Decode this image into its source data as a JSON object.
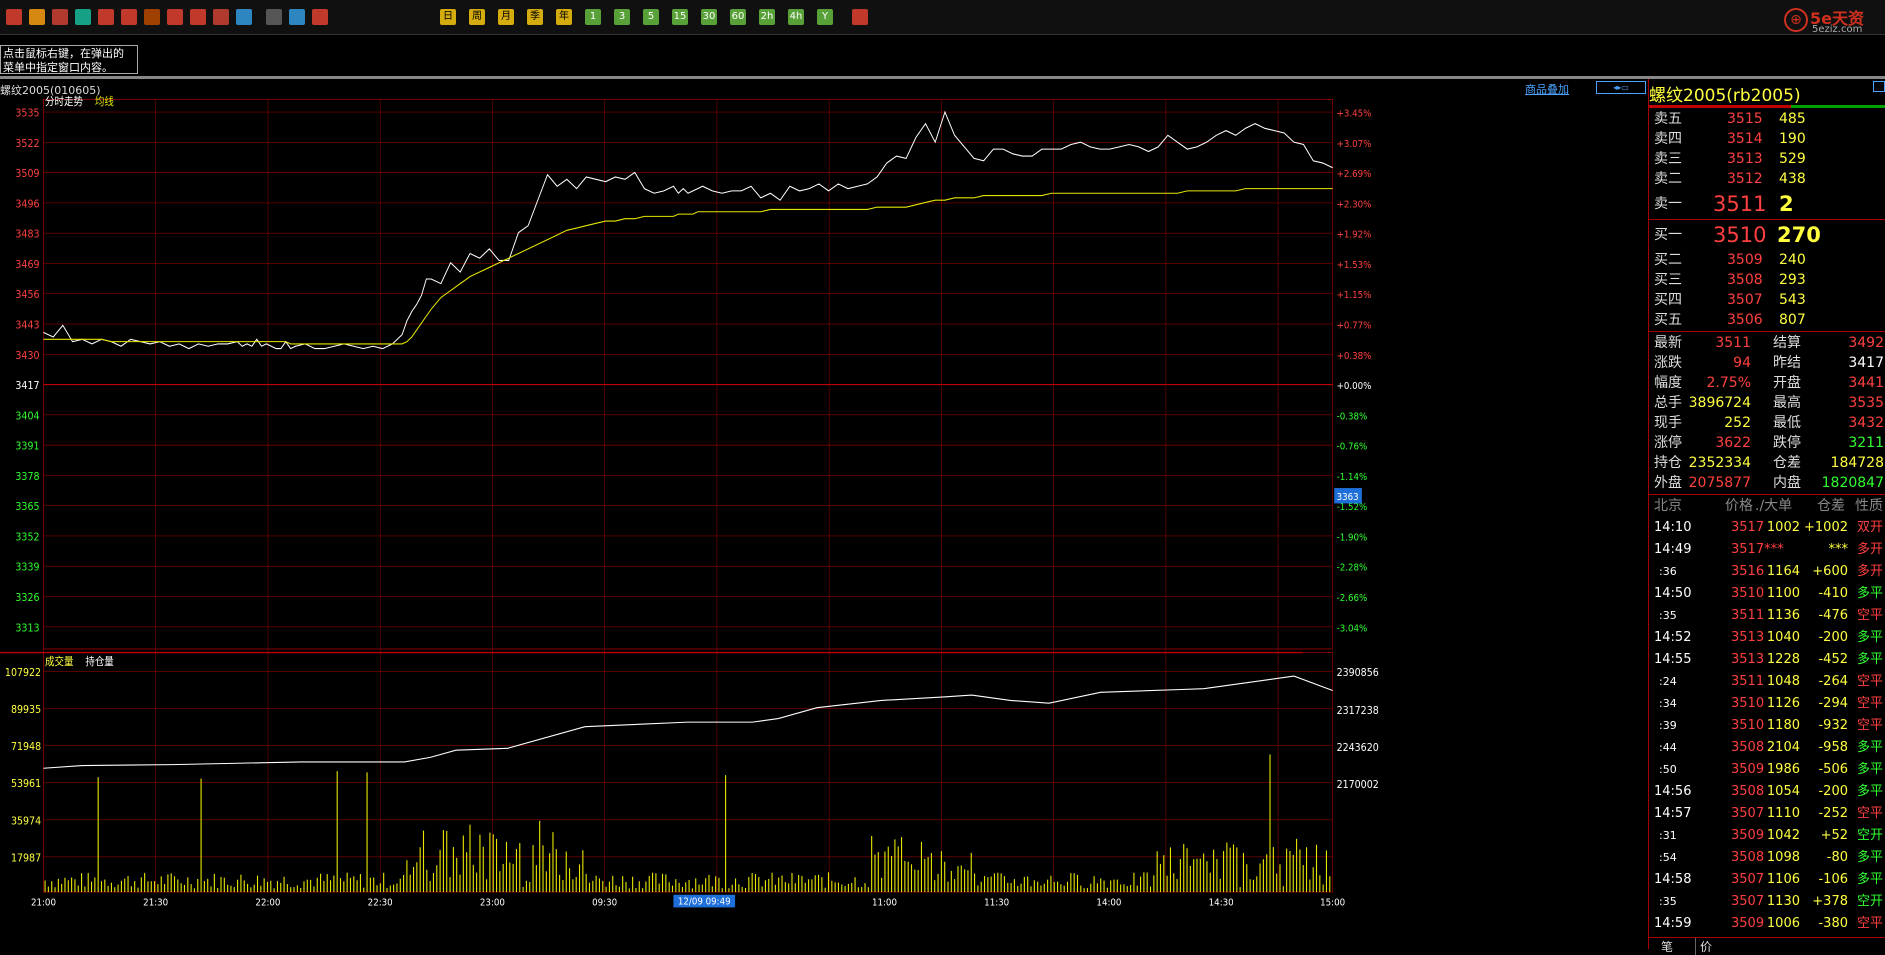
{
  "toolbar": {
    "icons": [
      "home-icon",
      "folder-icon",
      "chart-icon",
      "refresh-icon",
      "zoom-in-icon",
      "zoom-out-icon",
      "window-icon",
      "draw-icon",
      "brush-icon",
      "filter-icon",
      "analysis-icon",
      "table-icon",
      "trend-icon",
      "kline-icon",
      "period-daily",
      "period-weekly",
      "period-monthly",
      "period-quarterly",
      "period-yearly",
      "period-1min",
      "period-3min",
      "period-5min",
      "period-15min",
      "period-30min",
      "period-60min",
      "period-2h",
      "period-4h",
      "period-year",
      "calendar-icon"
    ],
    "period_labels": [
      "日",
      "周",
      "月",
      "季",
      "年",
      "1",
      "3",
      "5",
      "15",
      "30",
      "60",
      "2h",
      "4h",
      "Y"
    ]
  },
  "brand": {
    "name": "5e天资",
    "domain": "5eziz.com"
  },
  "tooltip": {
    "line1": "点击鼠标右键，在弹出的",
    "line2": "菜单中指定窗口内容。"
  },
  "symbol_line": "螺纹2005(010605)",
  "overlay_link": "商品叠加",
  "main_chart": {
    "legend": {
      "price_label": "分时走势",
      "avg_label": "均线"
    },
    "left_ticks": [
      "3535",
      "3522",
      "3509",
      "3496",
      "3483",
      "3469",
      "3456",
      "3443",
      "3430",
      "3417",
      "3404",
      "3391",
      "3378",
      "3365",
      "3352",
      "3339",
      "3326",
      "3313"
    ],
    "right_ticks": [
      "+3.45%",
      "+3.07%",
      "+2.69%",
      "+2.30%",
      "+1.92%",
      "+1.53%",
      "+1.15%",
      "+0.77%",
      "+0.38%",
      "+0.00%",
      "-0.38%",
      "-0.76%",
      "-1.14%",
      "-1.52%",
      "-1.90%",
      "-2.28%",
      "-2.66%",
      "-3.04%"
    ],
    "cursor_value": "3363",
    "prev_settle": 3417
  },
  "volume_chart": {
    "legend": {
      "volume_label": "成交量",
      "oi_label": "持仓量"
    },
    "left_ticks": [
      "107922",
      "89935",
      "71948",
      "53961",
      "35974",
      "17987"
    ],
    "right_ticks": [
      "2390856",
      "2317238",
      "2243620",
      "2170002"
    ]
  },
  "time_axis": [
    "21:00",
    "21:30",
    "22:00",
    "22:30",
    "23:00",
    "09:30",
    "10:00",
    "11:00",
    "11:30",
    "14:00",
    "14:30",
    "15:00"
  ],
  "time_cursor": "12/09 09:49",
  "chart_data": {
    "type": "line",
    "title": "螺纹2005(010605)",
    "x": [
      0,
      10,
      20,
      30,
      40,
      50,
      60,
      70,
      80,
      90,
      100,
      110,
      120,
      130,
      140,
      150,
      160,
      170,
      180,
      190,
      200,
      205,
      210,
      215,
      220,
      225,
      230,
      235,
      240,
      245,
      250,
      255,
      260,
      270,
      280,
      290,
      300,
      310,
      320,
      330,
      340,
      350,
      360,
      370,
      375,
      380,
      385,
      390,
      395,
      400,
      410,
      420,
      430,
      440,
      450,
      460,
      470,
      480,
      490,
      500,
      510,
      520,
      530,
      540,
      550,
      560,
      570,
      580,
      590,
      600,
      610,
      620,
      630,
      640,
      650,
      655,
      660,
      665,
      670,
      675,
      680,
      690,
      700,
      710,
      720,
      730,
      740,
      750,
      760,
      770,
      780,
      790,
      800,
      810,
      820,
      830,
      840,
      850,
      860,
      870,
      880,
      890,
      900,
      910,
      920,
      930,
      940,
      950,
      960,
      970,
      980,
      990,
      1000,
      1010,
      1020,
      1030,
      1040,
      1050,
      1060,
      1070,
      1080,
      1090,
      1100,
      1110,
      1120,
      1130,
      1140,
      1150,
      1160,
      1170,
      1180,
      1190,
      1200,
      1210,
      1220,
      1230,
      1240,
      1250,
      1260,
      1270,
      1280,
      1290,
      1300,
      1310,
      1320,
      1330
    ],
    "series": [
      {
        "name": "分时走势",
        "values": [
          3440,
          3438,
          3443,
          3436,
          3437,
          3435,
          3437,
          3436,
          3434,
          3437,
          3436,
          3435,
          3436,
          3434,
          3435,
          3433,
          3435,
          3434,
          3435,
          3435,
          3436,
          3434,
          3435,
          3434,
          3437,
          3434,
          3435,
          3434,
          3433,
          3433,
          3436,
          3433,
          3434,
          3435,
          3433,
          3433,
          3434,
          3435,
          3434,
          3433,
          3434,
          3433,
          3435,
          3439,
          3445,
          3449,
          3452,
          3456,
          3463,
          3463,
          3461,
          3470,
          3466,
          3474,
          3472,
          3476,
          3471,
          3471,
          3483,
          3486,
          3497,
          3508,
          3503,
          3506,
          3502,
          3507,
          3506,
          3505,
          3507,
          3506,
          3509,
          3502,
          3500,
          3501,
          3503,
          3500,
          3502,
          3500,
          3501,
          3502,
          3503,
          3501,
          3500,
          3501,
          3501,
          3503,
          3498,
          3500,
          3497,
          3503,
          3501,
          3502,
          3504,
          3501,
          3504,
          3502,
          3503,
          3504,
          3507,
          3513,
          3516,
          3515,
          3524,
          3530,
          3522,
          3535,
          3525,
          3520,
          3515,
          3514,
          3519,
          3519,
          3517,
          3516,
          3516,
          3519,
          3519,
          3519,
          3521,
          3522,
          3520,
          3519,
          3519,
          3520,
          3521,
          3520,
          3518,
          3520,
          3525,
          3522,
          3519,
          3520,
          3522,
          3525,
          3527,
          3525,
          3528,
          3530,
          3528,
          3527,
          3526,
          3522,
          3521,
          3514,
          3513,
          3511
        ]
      },
      {
        "name": "均线",
        "values": [
          3437,
          3437,
          3437,
          3437,
          3437,
          3437,
          3437,
          3436,
          3436,
          3436,
          3436,
          3436,
          3436,
          3436,
          3436,
          3436,
          3436,
          3436,
          3436,
          3436,
          3436,
          3436,
          3436,
          3436,
          3436,
          3436,
          3436,
          3436,
          3436,
          3436,
          3436,
          3435,
          3435,
          3435,
          3435,
          3435,
          3435,
          3435,
          3435,
          3435,
          3435,
          3435,
          3435,
          3435,
          3436,
          3438,
          3441,
          3444,
          3447,
          3450,
          3455,
          3458,
          3461,
          3464,
          3466,
          3468,
          3470,
          3472,
          3474,
          3476,
          3478,
          3480,
          3482,
          3484,
          3485,
          3486,
          3487,
          3488,
          3488,
          3489,
          3489,
          3490,
          3490,
          3490,
          3490,
          3491,
          3491,
          3491,
          3491,
          3492,
          3492,
          3492,
          3492,
          3492,
          3492,
          3492,
          3492,
          3493,
          3493,
          3493,
          3493,
          3493,
          3493,
          3493,
          3493,
          3493,
          3493,
          3493,
          3494,
          3494,
          3494,
          3494,
          3495,
          3496,
          3497,
          3497,
          3498,
          3498,
          3498,
          3499,
          3499,
          3499,
          3499,
          3499,
          3499,
          3499,
          3500,
          3500,
          3500,
          3500,
          3500,
          3500,
          3500,
          3500,
          3500,
          3500,
          3500,
          3500,
          3500,
          3500,
          3501,
          3501,
          3501,
          3501,
          3501,
          3501,
          3502,
          3502,
          3502,
          3502,
          3502,
          3502,
          3502,
          3502,
          3502,
          3502
        ]
      }
    ],
    "ylim": [
      3313,
      3535
    ]
  },
  "quote": {
    "title": "螺纹2005(rb2005)",
    "asks": [
      {
        "label": "卖五",
        "price": "3515",
        "vol": "485"
      },
      {
        "label": "卖四",
        "price": "3514",
        "vol": "190"
      },
      {
        "label": "卖三",
        "price": "3513",
        "vol": "529"
      },
      {
        "label": "卖二",
        "price": "3512",
        "vol": "438"
      }
    ],
    "ask1": {
      "label": "卖一",
      "price": "3511",
      "vol": "2"
    },
    "bid1": {
      "label": "买一",
      "price": "3510",
      "vol": "270"
    },
    "bids": [
      {
        "label": "买二",
        "price": "3509",
        "vol": "240"
      },
      {
        "label": "买三",
        "price": "3508",
        "vol": "293"
      },
      {
        "label": "买四",
        "price": "3507",
        "vol": "543"
      },
      {
        "label": "买五",
        "price": "3506",
        "vol": "807"
      }
    ],
    "stats": [
      {
        "l1": "最新",
        "v1": "3511",
        "c1": "#ff4040",
        "l2": "结算",
        "v2": "3492",
        "c2": "#ff4040"
      },
      {
        "l1": "涨跌",
        "v1": "94",
        "c1": "#ff4040",
        "l2": "昨结",
        "v2": "3417",
        "c2": "#ffffff"
      },
      {
        "l1": "幅度",
        "v1": "2.75%",
        "c1": "#ff4040",
        "l2": "开盘",
        "v2": "3441",
        "c2": "#ff4040"
      },
      {
        "l1": "总手",
        "v1": "3896724",
        "c1": "#ffff40",
        "l2": "最高",
        "v2": "3535",
        "c2": "#ff4040"
      },
      {
        "l1": "现手",
        "v1": "252",
        "c1": "#ffff40",
        "l2": "最低",
        "v2": "3432",
        "c2": "#ff4040"
      },
      {
        "l1": "涨停",
        "v1": "3622",
        "c1": "#ff4040",
        "l2": "跌停",
        "v2": "3211",
        "c2": "#30ff30"
      },
      {
        "l1": "持仓",
        "v1": "2352334",
        "c1": "#ffff40",
        "l2": "仓差",
        "v2": "184728",
        "c2": "#ffff40"
      },
      {
        "l1": "外盘",
        "v1": "2075877",
        "c1": "#ff4040",
        "l2": "内盘",
        "v2": "1820847",
        "c2": "#30ff30"
      }
    ],
    "ticks_header": {
      "time": "北京",
      "price": "价格",
      "vol": "./大单",
      "oi": "仓差",
      "nature": "性质"
    },
    "ticks": [
      {
        "t": "14:10",
        "p": "3517",
        "v": "1002",
        "oi": "+1002",
        "n": "双开",
        "pc": "#ff4040",
        "nc": "#ff4040",
        "big": true
      },
      {
        "t": "14:49",
        "p": "3517***",
        "v": "",
        "oi": "***",
        "n": "多开",
        "pc": "#ff4040",
        "nc": "#ff4040",
        "big": true
      },
      {
        "t": ":36",
        "p": "3516",
        "v": "1164",
        "oi": "+600",
        "n": "多开",
        "pc": "#ff4040",
        "nc": "#ff4040",
        "big": false
      },
      {
        "t": "14:50",
        "p": "3510",
        "v": "1100",
        "oi": "-410",
        "n": "多平",
        "pc": "#ff4040",
        "nc": "#30ff30",
        "big": true
      },
      {
        "t": ":35",
        "p": "3511",
        "v": "1136",
        "oi": "-476",
        "n": "空平",
        "pc": "#ff4040",
        "nc": "#ff4040",
        "big": false
      },
      {
        "t": "14:52",
        "p": "3513",
        "v": "1040",
        "oi": "-200",
        "n": "多平",
        "pc": "#ff4040",
        "nc": "#30ff30",
        "big": true
      },
      {
        "t": "14:55",
        "p": "3513",
        "v": "1228",
        "oi": "-452",
        "n": "多平",
        "pc": "#ff4040",
        "nc": "#30ff30",
        "big": true
      },
      {
        "t": ":24",
        "p": "3511",
        "v": "1048",
        "oi": "-264",
        "n": "空平",
        "pc": "#ff4040",
        "nc": "#ff4040",
        "big": false
      },
      {
        "t": ":34",
        "p": "3510",
        "v": "1126",
        "oi": "-294",
        "n": "空平",
        "pc": "#ff4040",
        "nc": "#ff4040",
        "big": false
      },
      {
        "t": ":39",
        "p": "3510",
        "v": "1180",
        "oi": "-932",
        "n": "空平",
        "pc": "#ff4040",
        "nc": "#ff4040",
        "big": false
      },
      {
        "t": ":44",
        "p": "3508",
        "v": "2104",
        "oi": "-958",
        "n": "多平",
        "pc": "#ff4040",
        "nc": "#30ff30",
        "big": false
      },
      {
        "t": ":50",
        "p": "3509",
        "v": "1986",
        "oi": "-506",
        "n": "多平",
        "pc": "#ff4040",
        "nc": "#30ff30",
        "big": false
      },
      {
        "t": "14:56",
        "p": "3508",
        "v": "1054",
        "oi": "-200",
        "n": "多平",
        "pc": "#ff4040",
        "nc": "#30ff30",
        "big": true
      },
      {
        "t": "14:57",
        "p": "3507",
        "v": "1110",
        "oi": "-252",
        "n": "空平",
        "pc": "#ff4040",
        "nc": "#ff4040",
        "big": true
      },
      {
        "t": ":31",
        "p": "3509",
        "v": "1042",
        "oi": "+52",
        "n": "空开",
        "pc": "#ff4040",
        "nc": "#30ff30",
        "big": false
      },
      {
        "t": ":54",
        "p": "3508",
        "v": "1098",
        "oi": "-80",
        "n": "多平",
        "pc": "#ff4040",
        "nc": "#30ff30",
        "big": false
      },
      {
        "t": "14:58",
        "p": "3507",
        "v": "1106",
        "oi": "-106",
        "n": "多平",
        "pc": "#ff4040",
        "nc": "#30ff30",
        "big": true
      },
      {
        "t": ":35",
        "p": "3507",
        "v": "1130",
        "oi": "+378",
        "n": "空开",
        "pc": "#ff4040",
        "nc": "#30ff30",
        "big": false
      },
      {
        "t": "14:59",
        "p": "3509",
        "v": "1006",
        "oi": "-380",
        "n": "空平",
        "pc": "#ff4040",
        "nc": "#ff4040",
        "big": true
      }
    ],
    "bottom_tabs": [
      "笔",
      "价"
    ]
  },
  "colors": {
    "grid": "#8b0000",
    "up": "#ff4040",
    "down": "#30ff30",
    "price_line": "#ffffff",
    "avg_line": "#e6e600",
    "volume_bar": "#e6e600",
    "oi_line": "#ffffff"
  }
}
